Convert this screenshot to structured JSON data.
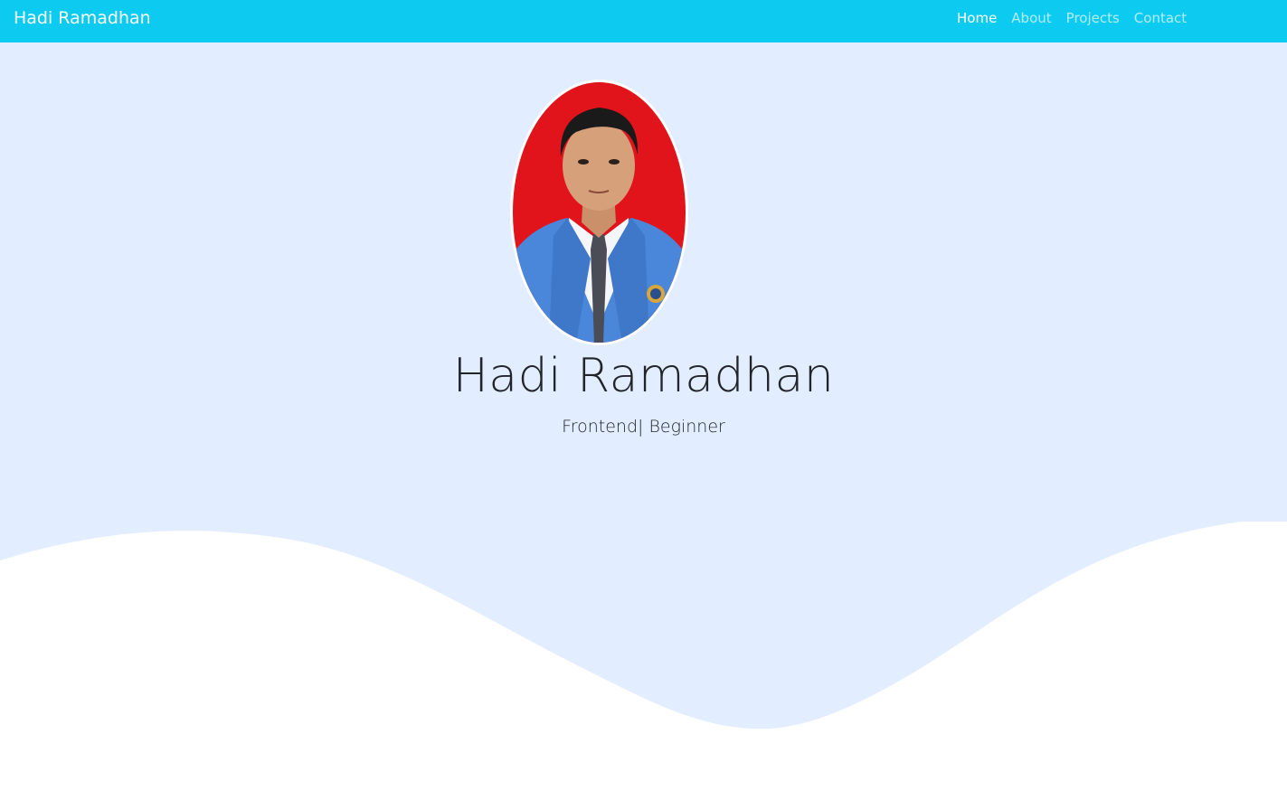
{
  "navbar": {
    "brand": "Hadi Ramadhan",
    "links": [
      {
        "label": "Home",
        "active": true
      },
      {
        "label": "About",
        "active": false
      },
      {
        "label": "Projects",
        "active": false
      },
      {
        "label": "Contact",
        "active": false
      }
    ]
  },
  "hero": {
    "name": "Hadi Ramadhan",
    "tagline": "Frontend| Beginner",
    "photo_icon": "profile-photo"
  },
  "colors": {
    "navbar_bg": "#0dcaf0",
    "hero_bg": "#e2edff",
    "wave": "#ffffff",
    "photo_bg": "#e0141a",
    "jacket": "#4a86d9"
  }
}
